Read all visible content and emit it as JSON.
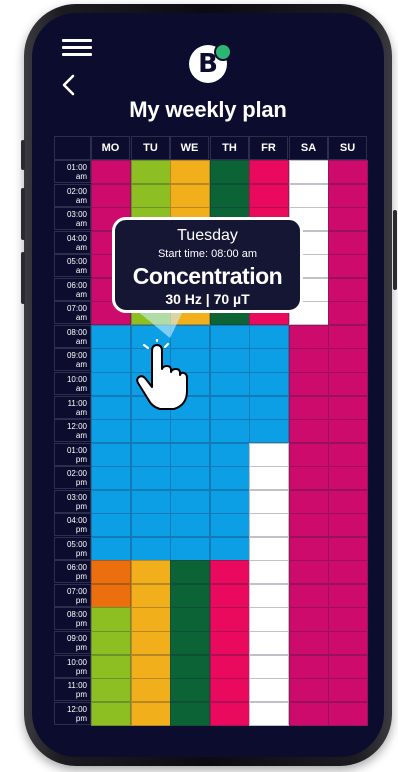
{
  "header": {
    "title": "My weekly plan",
    "logo_letter": "B",
    "menu_icon": "hamburger-menu-icon",
    "back_icon": "chevron-left-icon"
  },
  "days": [
    "MO",
    "TU",
    "WE",
    "TH",
    "FR",
    "SA",
    "SU"
  ],
  "times": [
    [
      "01:00",
      "am"
    ],
    [
      "02:00",
      "am"
    ],
    [
      "03:00",
      "am"
    ],
    [
      "04:00",
      "am"
    ],
    [
      "05:00",
      "am"
    ],
    [
      "06:00",
      "am"
    ],
    [
      "07:00",
      "am"
    ],
    [
      "08:00",
      "am"
    ],
    [
      "09:00",
      "am"
    ],
    [
      "10:00",
      "am"
    ],
    [
      "11:00",
      "am"
    ],
    [
      "12:00",
      "am"
    ],
    [
      "01:00",
      "pm"
    ],
    [
      "02:00",
      "pm"
    ],
    [
      "03:00",
      "pm"
    ],
    [
      "04:00",
      "pm"
    ],
    [
      "05:00",
      "pm"
    ],
    [
      "06:00",
      "pm"
    ],
    [
      "07:00",
      "pm"
    ],
    [
      "08:00",
      "pm"
    ],
    [
      "09:00",
      "pm"
    ],
    [
      "10:00",
      "pm"
    ],
    [
      "11:00",
      "pm"
    ],
    [
      "12:00",
      "pm"
    ]
  ],
  "colors": {
    "P": "#cc0b6c",
    "L": "#8dbe22",
    "Y": "#f1b01b",
    "D": "#0b6336",
    "R": "#e90a5e",
    "W": "#ffffff",
    "B": "#0d9fe6",
    "O": "#ec6f0e"
  },
  "schedule": [
    [
      "P",
      "L",
      "Y",
      "D",
      "R",
      "W",
      "P"
    ],
    [
      "P",
      "L",
      "Y",
      "D",
      "R",
      "W",
      "P"
    ],
    [
      "P",
      "L",
      "Y",
      "D",
      "R",
      "W",
      "P"
    ],
    [
      "P",
      "L",
      "Y",
      "D",
      "R",
      "W",
      "P"
    ],
    [
      "P",
      "L",
      "Y",
      "D",
      "R",
      "W",
      "P"
    ],
    [
      "P",
      "L",
      "Y",
      "D",
      "R",
      "W",
      "P"
    ],
    [
      "P",
      "L",
      "Y",
      "D",
      "R",
      "W",
      "P"
    ],
    [
      "B",
      "B",
      "B",
      "B",
      "B",
      "P",
      "P"
    ],
    [
      "B",
      "B",
      "B",
      "B",
      "B",
      "P",
      "P"
    ],
    [
      "B",
      "B",
      "B",
      "B",
      "B",
      "P",
      "P"
    ],
    [
      "B",
      "B",
      "B",
      "B",
      "B",
      "P",
      "P"
    ],
    [
      "B",
      "B",
      "B",
      "B",
      "B",
      "P",
      "P"
    ],
    [
      "B",
      "B",
      "B",
      "B",
      "W",
      "P",
      "P"
    ],
    [
      "B",
      "B",
      "B",
      "B",
      "W",
      "P",
      "P"
    ],
    [
      "B",
      "B",
      "B",
      "B",
      "W",
      "P",
      "P"
    ],
    [
      "B",
      "B",
      "B",
      "B",
      "W",
      "P",
      "P"
    ],
    [
      "B",
      "B",
      "B",
      "B",
      "W",
      "P",
      "P"
    ],
    [
      "O",
      "Y",
      "D",
      "R",
      "W",
      "P",
      "P"
    ],
    [
      "O",
      "Y",
      "D",
      "R",
      "W",
      "P",
      "P"
    ],
    [
      "L",
      "Y",
      "D",
      "R",
      "W",
      "P",
      "P"
    ],
    [
      "L",
      "Y",
      "D",
      "R",
      "W",
      "P",
      "P"
    ],
    [
      "L",
      "Y",
      "D",
      "R",
      "W",
      "P",
      "P"
    ],
    [
      "L",
      "Y",
      "D",
      "R",
      "W",
      "P",
      "P"
    ],
    [
      "L",
      "Y",
      "D",
      "R",
      "W",
      "P",
      "P"
    ]
  ],
  "tooltip": {
    "day": "Tuesday",
    "start_time": "Start time: 08:00 am",
    "program": "Concentration",
    "params": "30 Hz | 70 µT"
  },
  "pointer": {
    "icon": "tap-hand-icon"
  }
}
